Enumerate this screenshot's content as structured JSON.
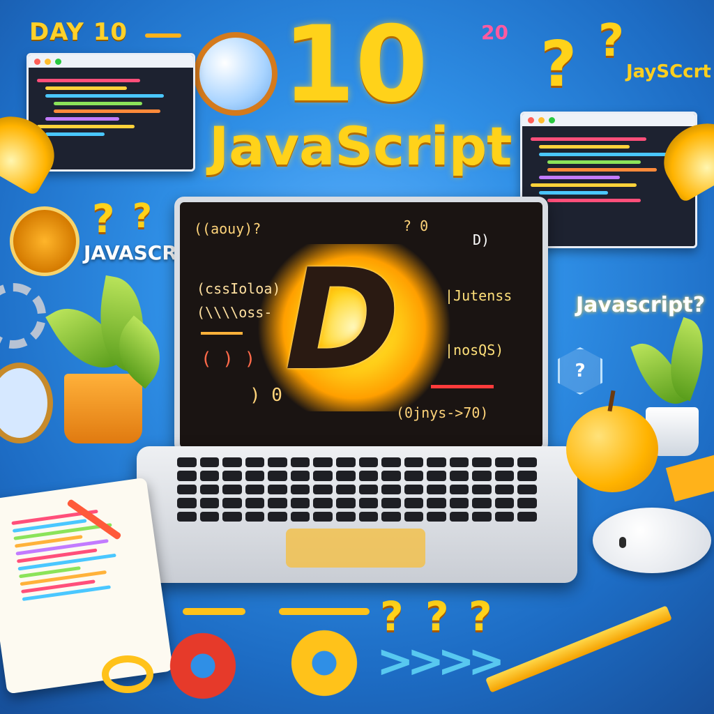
{
  "header": {
    "day_label": "DAY 10",
    "big_number": "10",
    "title": "JavaScript"
  },
  "side_labels": {
    "left_js": "JAVASCRIPT",
    "top_right": "JaySCcrt",
    "right_js": "Javascript?"
  },
  "screen": {
    "line1": "((aouy)?",
    "line2": "? 0",
    "line3": "D)",
    "line4": "(cssIoloa)",
    "line5": "(\\\\\\\\oss-",
    "line6": "|Jutenss",
    "line7": "( ) )",
    "line8": "|nosQS)",
    "line9": "(0jnys->70)",
    "line10": ") 0",
    "logo_glyph": "D"
  },
  "decorations": {
    "question_mark": "?",
    "number_20": "20",
    "gear_icon": "gear-icon",
    "plant_icon": "plant-icon",
    "lamp_icon": "lamp-icon",
    "apple_icon": "apple-icon",
    "mouse_icon": "mouse-icon",
    "notebook_icon": "notebook-icon",
    "pencil_icon": "pencil-icon"
  },
  "colors": {
    "accent_yellow": "#ffd21a",
    "background_blue": "#2f8fe6",
    "screen_dark": "#1a1412"
  }
}
